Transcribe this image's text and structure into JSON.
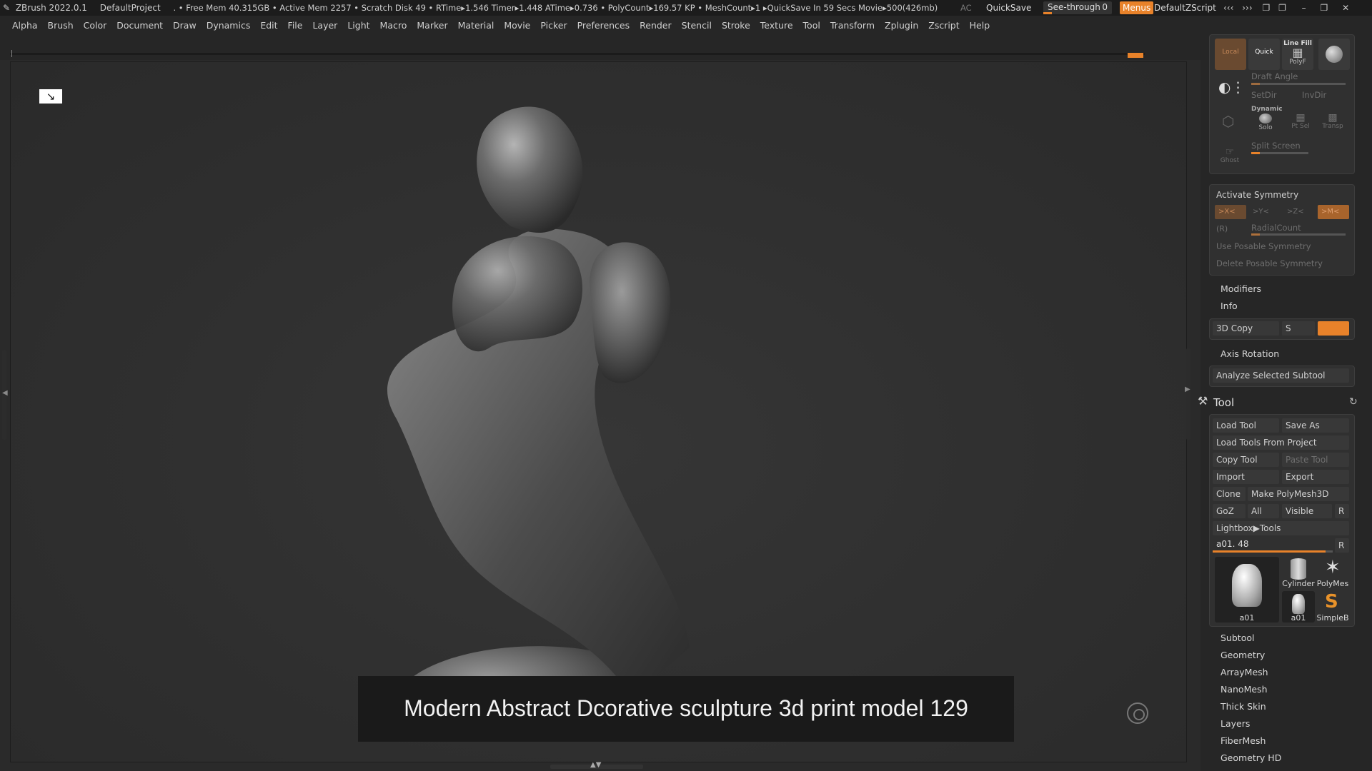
{
  "titlebar": {
    "app": "ZBrush 2022.0.1",
    "project": "DefaultProject",
    "stats": ". • Free Mem 40.315GB • Active Mem 2257 • Scratch Disk 49 •  RTime▸1.546 Timer▸1.448 ATime▸0.736 • PolyCount▸169.57 KP  • MeshCount▸1  ▸QuickSave In 59 Secs Movie▸500(426mb)",
    "ac": "AC",
    "quicksave": "QuickSave",
    "seethrough": "See-through",
    "seethrough_value": "0",
    "menus": "Menus",
    "script": "DefaultZScript"
  },
  "menubar": [
    "Alpha",
    "Brush",
    "Color",
    "Document",
    "Draw",
    "Dynamics",
    "Edit",
    "File",
    "Layer",
    "Light",
    "Macro",
    "Marker",
    "Material",
    "Movie",
    "Picker",
    "Preferences",
    "Render",
    "Stencil",
    "Stroke",
    "Texture",
    "Tool",
    "Transform",
    "Zplugin",
    "Zscript",
    "Help"
  ],
  "caption": "Modern Abstract Dcorative sculpture 3d print model 129",
  "rightpanel": {
    "top": {
      "local": "Local",
      "quick": "Quick",
      "line_fill": "Line Fill",
      "polyf": "PolyF",
      "draft_angle": "Draft Angle",
      "setdir": "SetDir",
      "invdir": "InvDir",
      "dynamic": "Dynamic",
      "solo": "Solo",
      "ptsel": "Pt Sel",
      "transp": "Transp",
      "split_screen": "Split Screen",
      "ghost": "Ghost"
    },
    "symmetry": {
      "activate": "Activate Symmetry",
      "x": ">X<",
      "y": ">Y<",
      "z": ">Z<",
      "m": ">M<",
      "r": "(R)",
      "radial": "RadialCount",
      "use_posable": "Use Posable Symmetry",
      "delete_posable": "Delete Posable Symmetry"
    },
    "modifiers": "Modifiers",
    "info": "Info",
    "copy3d": "3D Copy",
    "copy3d_s": "S",
    "axis_rotation": "Axis Rotation",
    "analyze": "Analyze Selected Subtool",
    "tool": {
      "title": "Tool",
      "load_tool": "Load Tool",
      "save_as": "Save As",
      "load_from_project": "Load Tools From Project",
      "copy_tool": "Copy Tool",
      "paste_tool": "Paste Tool",
      "import": "Import",
      "export": "Export",
      "clone": "Clone",
      "make_polymesh": "Make PolyMesh3D",
      "goz": "GoZ",
      "all": "All",
      "visible": "Visible",
      "r": "R",
      "lightbox": "Lightbox▶Tools",
      "current": "a01. 48",
      "current_r": "R",
      "thumbs": [
        "a01",
        "Cylinder",
        "PolyMes",
        "a01",
        "SimpleB"
      ]
    },
    "sections": [
      "Subtool",
      "Geometry",
      "ArrayMesh",
      "NanoMesh",
      "Thick Skin",
      "Layers",
      "FiberMesh",
      "Geometry HD"
    ]
  }
}
